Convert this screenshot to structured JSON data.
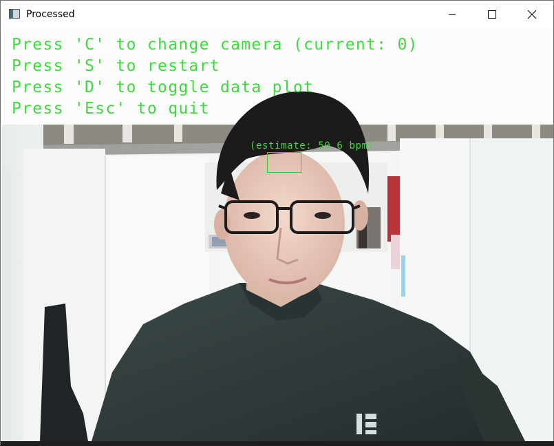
{
  "window": {
    "title": "Processed",
    "controls": {
      "minimize": "minimize-icon",
      "maximize": "maximize-icon",
      "close": "close-icon"
    }
  },
  "overlay": {
    "lines": [
      "Press 'C' to change camera (current: 0)",
      "Press 'S' to restart",
      "Press 'D' to toggle data plot",
      "Press 'Esc' to quit"
    ],
    "estimate": "(estimate: 50.6 bpm)",
    "color": "#3ddc3d"
  },
  "feed": {
    "subject": "person wearing glasses and dark t-shirt in a bright room"
  }
}
